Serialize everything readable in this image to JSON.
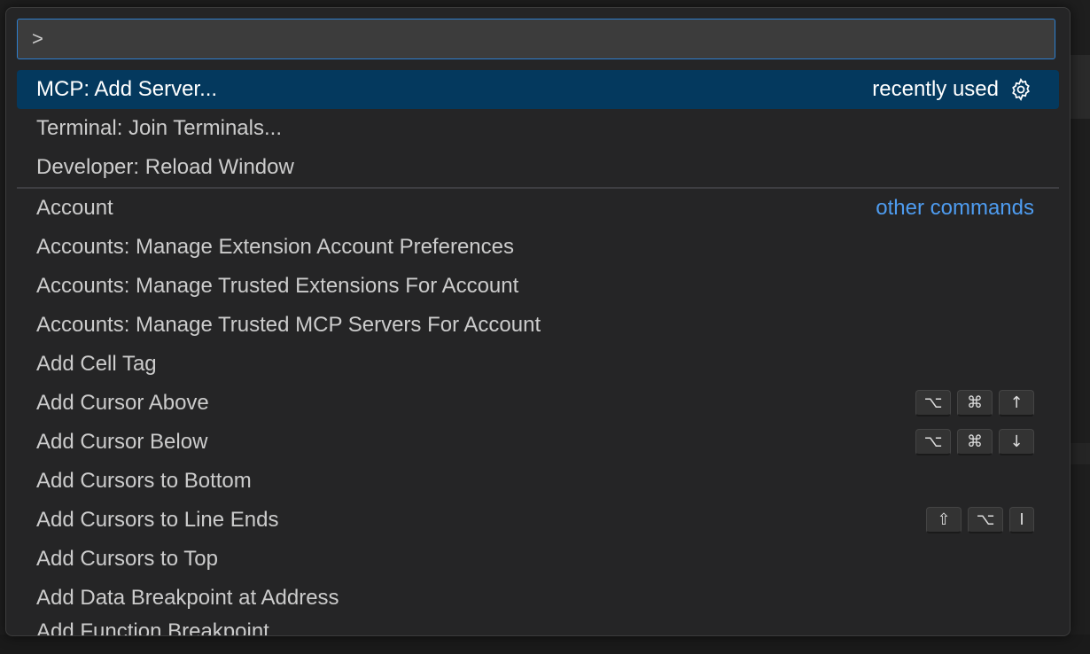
{
  "input": {
    "value": ">",
    "placeholder": ""
  },
  "items": [
    {
      "label": "MCP: Add Server...",
      "tag": "recently used",
      "icon": "gear-icon",
      "selected": true
    },
    {
      "label": "Terminal: Join Terminals..."
    },
    {
      "label": "Developer: Reload Window"
    },
    {
      "label": "Account",
      "link": "other commands"
    },
    {
      "label": "Accounts: Manage Extension Account Preferences"
    },
    {
      "label": "Accounts: Manage Trusted Extensions For Account"
    },
    {
      "label": "Accounts: Manage Trusted MCP Servers For Account"
    },
    {
      "label": "Add Cell Tag"
    },
    {
      "label": "Add Cursor Above",
      "keys": [
        "⌥",
        "⌘",
        "↑"
      ]
    },
    {
      "label": "Add Cursor Below",
      "keys": [
        "⌥",
        "⌘",
        "↓"
      ]
    },
    {
      "label": "Add Cursors to Bottom"
    },
    {
      "label": "Add Cursors to Line Ends",
      "keys": [
        "⇧",
        "⌥",
        "I"
      ]
    },
    {
      "label": "Add Cursors to Top"
    },
    {
      "label": "Add Data Breakpoint at Address"
    },
    {
      "label": "Add Function Breakpoint"
    }
  ],
  "colors": {
    "accent": "#2d7fd0",
    "selection": "#04395e",
    "link": "#4e9cf0"
  }
}
